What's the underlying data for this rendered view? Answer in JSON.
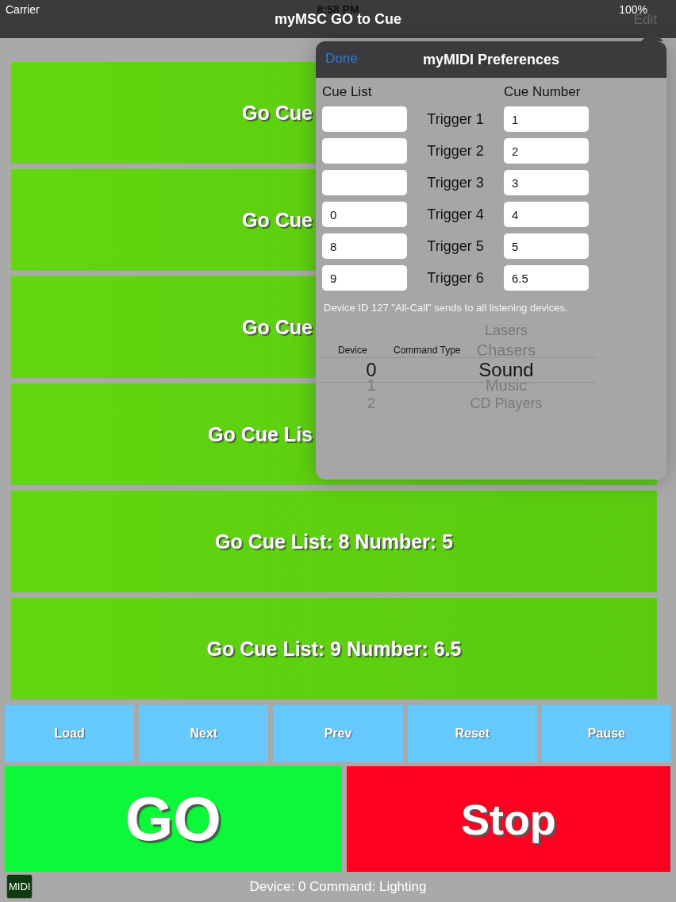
{
  "status_bar": {
    "carrier": "Carrier",
    "time": "8:58 PM",
    "battery": "100%"
  },
  "nav_bar": {
    "title": "myMSC GO to Cue",
    "edit": "Edit"
  },
  "cues": [
    {
      "label": "Go Cue",
      "kind": "covered"
    },
    {
      "label": "Go Cue",
      "kind": "covered"
    },
    {
      "label": "Go Cue",
      "kind": "covered"
    },
    {
      "label": "Go Cue Lis",
      "kind": "covered"
    },
    {
      "label": "Go Cue List: 8 Number: 5",
      "kind": "full"
    },
    {
      "label": "Go Cue List: 9 Number: 6.5",
      "kind": "full"
    }
  ],
  "controls": [
    "Load",
    "Next",
    "Prev",
    "Reset",
    "Pause"
  ],
  "go": "GO",
  "stop": "Stop",
  "footer": {
    "badge": "MIDI",
    "status": "Device: 0 Command: Lighting"
  },
  "preferences": {
    "done": "Done",
    "title": "myMIDI Preferences",
    "cue_list_heading": "Cue List",
    "cue_number_heading": "Cue Number",
    "triggers": [
      {
        "label": "Trigger 1",
        "cue_number": "1"
      },
      {
        "label": "Trigger 2",
        "cue_number": "2"
      },
      {
        "label": "Trigger 3",
        "cue_number": "3"
      },
      {
        "label": "Trigger 4",
        "cue_list": "0",
        "cue_number": "4"
      },
      {
        "label": "Trigger 5",
        "cue_list": "8",
        "cue_number": "5"
      },
      {
        "label": "Trigger 6",
        "cue_list": "9",
        "cue_number": "6.5"
      }
    ],
    "note": "Device ID 127 \"All-Call\" sends to all listening devices.",
    "picker": {
      "device_heading": "Device",
      "command_heading": "Command Type",
      "devices": [
        {
          "label": "0",
          "selected": true
        },
        {
          "label": "1",
          "selected": false
        },
        {
          "label": "2",
          "selected": false
        }
      ],
      "commands": [
        {
          "label": "Lasers",
          "selected": false
        },
        {
          "label": "Chasers",
          "selected": false
        },
        {
          "label": "Sound",
          "selected": true
        },
        {
          "label": "Music",
          "selected": false
        },
        {
          "label": "CD Players",
          "selected": false
        }
      ]
    }
  }
}
